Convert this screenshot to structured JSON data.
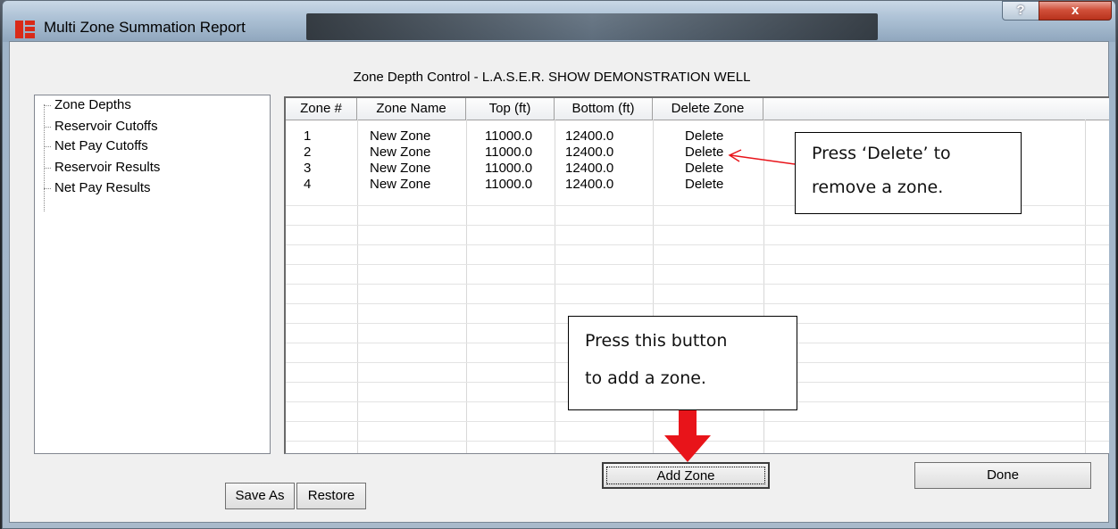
{
  "window": {
    "title": "Multi Zone Summation Report",
    "help_label": "?",
    "close_label": "x"
  },
  "heading": "Zone Depth Control - L.A.S.E.R. SHOW DEMONSTRATION WELL",
  "tree": {
    "items": [
      {
        "label": "Zone Depths"
      },
      {
        "label": "Reservoir Cutoffs"
      },
      {
        "label": "Net Pay Cutoffs"
      },
      {
        "label": "Reservoir Results"
      },
      {
        "label": "Net Pay Results"
      }
    ]
  },
  "grid": {
    "columns": [
      "Zone #",
      "Zone Name",
      "Top (ft)",
      "Bottom (ft)",
      "Delete Zone"
    ],
    "rows": [
      {
        "zone": "1",
        "name": "New Zone",
        "top": "11000.0",
        "bottom": "12400.0",
        "delete": "Delete"
      },
      {
        "zone": "2",
        "name": "New Zone",
        "top": "11000.0",
        "bottom": "12400.0",
        "delete": "Delete"
      },
      {
        "zone": "3",
        "name": "New Zone",
        "top": "11000.0",
        "bottom": "12400.0",
        "delete": "Delete"
      },
      {
        "zone": "4",
        "name": "New Zone",
        "top": "11000.0",
        "bottom": "12400.0",
        "delete": "Delete"
      }
    ]
  },
  "buttons": {
    "save_as": "Save As",
    "restore": "Restore",
    "add_zone": "Add Zone",
    "done": "Done"
  },
  "callouts": {
    "delete_line1": "Press  ‘Delete’ to",
    "delete_line2": "remove a zone.",
    "add_line1": "Press this button",
    "add_line2": "to add a zone."
  },
  "colors": {
    "annotation_arrow": "#e8141a",
    "close_button": "#c8452c",
    "app_icon": "#d92a18"
  }
}
